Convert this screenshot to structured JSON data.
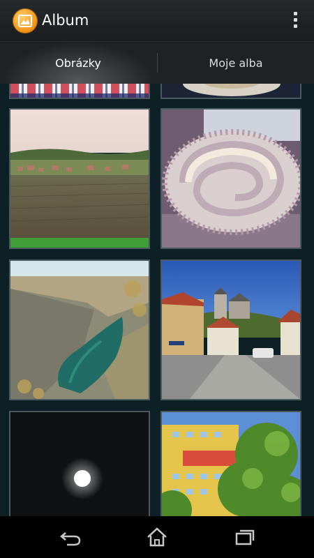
{
  "app": {
    "title": "Album",
    "icon": "album-app-icon"
  },
  "actionbar": {
    "overflow_icon": "overflow-menu-icon"
  },
  "tabs": [
    {
      "label": "Obrázky",
      "selected": true
    },
    {
      "label": "Moje alba",
      "selected": false
    }
  ],
  "photos": [
    {
      "name": "photo-checkered-fabric"
    },
    {
      "name": "photo-plate"
    },
    {
      "name": "photo-village-landscape"
    },
    {
      "name": "photo-cake-roll"
    },
    {
      "name": "photo-quarry-lake"
    },
    {
      "name": "photo-castle-street"
    },
    {
      "name": "photo-full-moon"
    },
    {
      "name": "photo-building-trees"
    }
  ],
  "navbar": {
    "back_icon": "back-icon",
    "home_icon": "home-icon",
    "recents_icon": "recent-apps-icon"
  }
}
